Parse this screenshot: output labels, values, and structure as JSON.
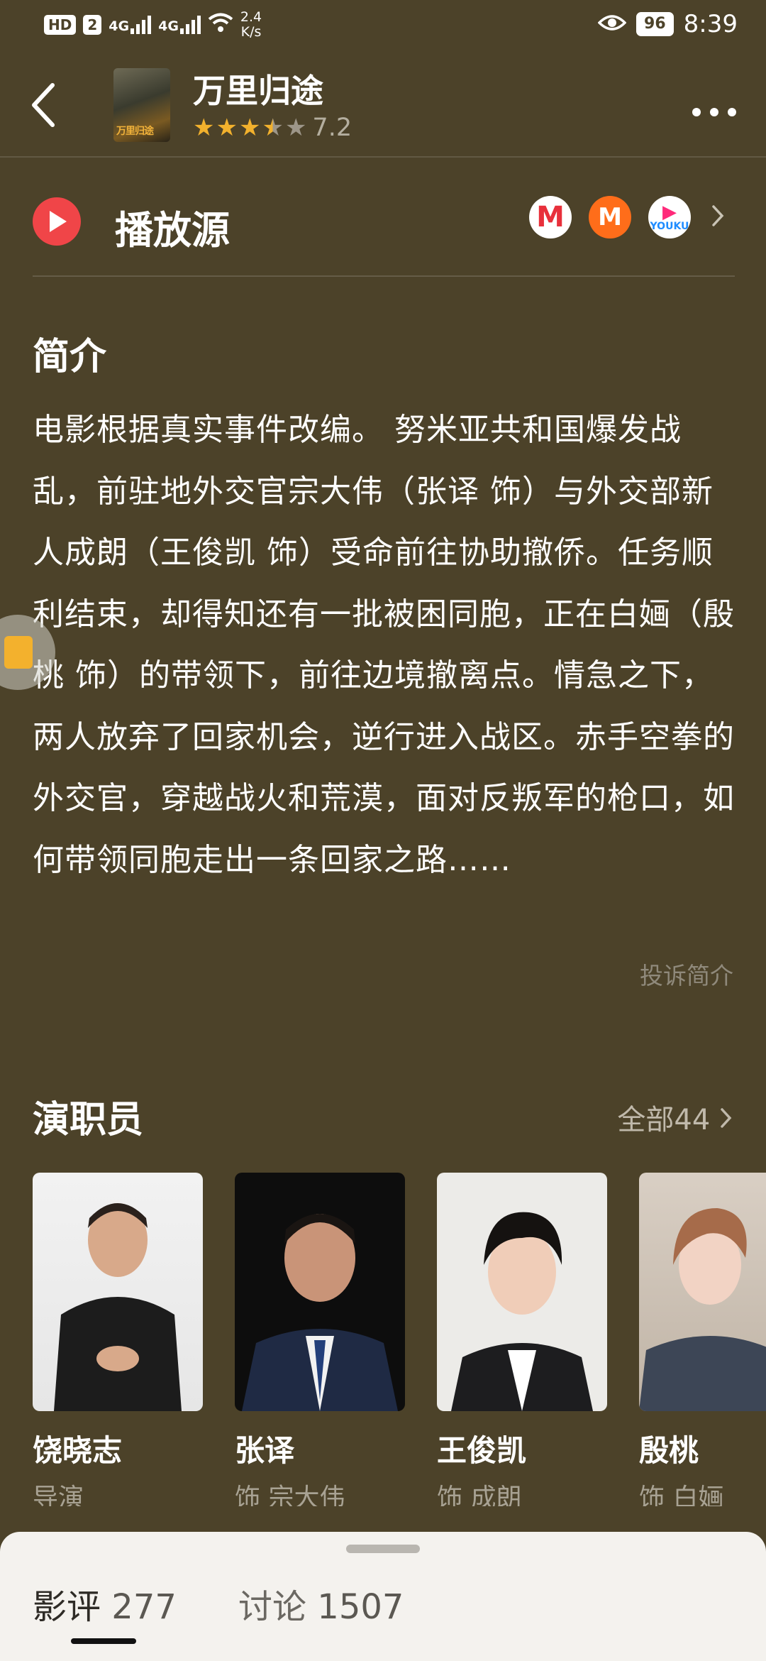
{
  "status_bar": {
    "hd": "HD",
    "sim": "2",
    "net1": "4G",
    "net2": "4G",
    "speed_value": "2.4",
    "speed_unit": "K/s",
    "battery": "96",
    "time": "8:39"
  },
  "header": {
    "title": "万里归途",
    "rating_stars": 3.5,
    "score": "7.2",
    "poster_text": "万里归途"
  },
  "source": {
    "label": "播放源",
    "platforms": [
      "mgtv-like M",
      "mango",
      "youku"
    ],
    "youku_text": "YOUKU"
  },
  "intro": {
    "title": "简介",
    "text": "电影根据真实事件改编。 努米亚共和国爆发战乱，前驻地外交官宗大伟（张译 饰）与外交部新人成朗（王俊凯 饰）受命前往协助撤侨。任务顺利结束，却得知还有一批被困同胞，正在白婳（殷桃 饰）的带领下，前往边境撤离点。情急之下，两人放弃了回家机会，逆行进入战区。赤手空拳的外交官，穿越战火和荒漠，面对反叛军的枪口，如何带领同胞走出一条回家之路……",
    "complain": "投诉简介"
  },
  "cast": {
    "title": "演职员",
    "all_label": "全部44",
    "members": [
      {
        "name": "饶晓志",
        "role": "导演"
      },
      {
        "name": "张译",
        "role": "饰 宗大伟"
      },
      {
        "name": "王俊凯",
        "role": "饰 成朗"
      },
      {
        "name": "殷桃",
        "role": "饰 白婳"
      }
    ]
  },
  "bottom_tabs": [
    {
      "label": "影评",
      "count": "277"
    },
    {
      "label": "讨论",
      "count": "1507"
    }
  ],
  "colors": {
    "background": "#4c4229",
    "star": "#f2b12d",
    "play_red": "#f04548",
    "sheet": "#f4f2ee"
  }
}
